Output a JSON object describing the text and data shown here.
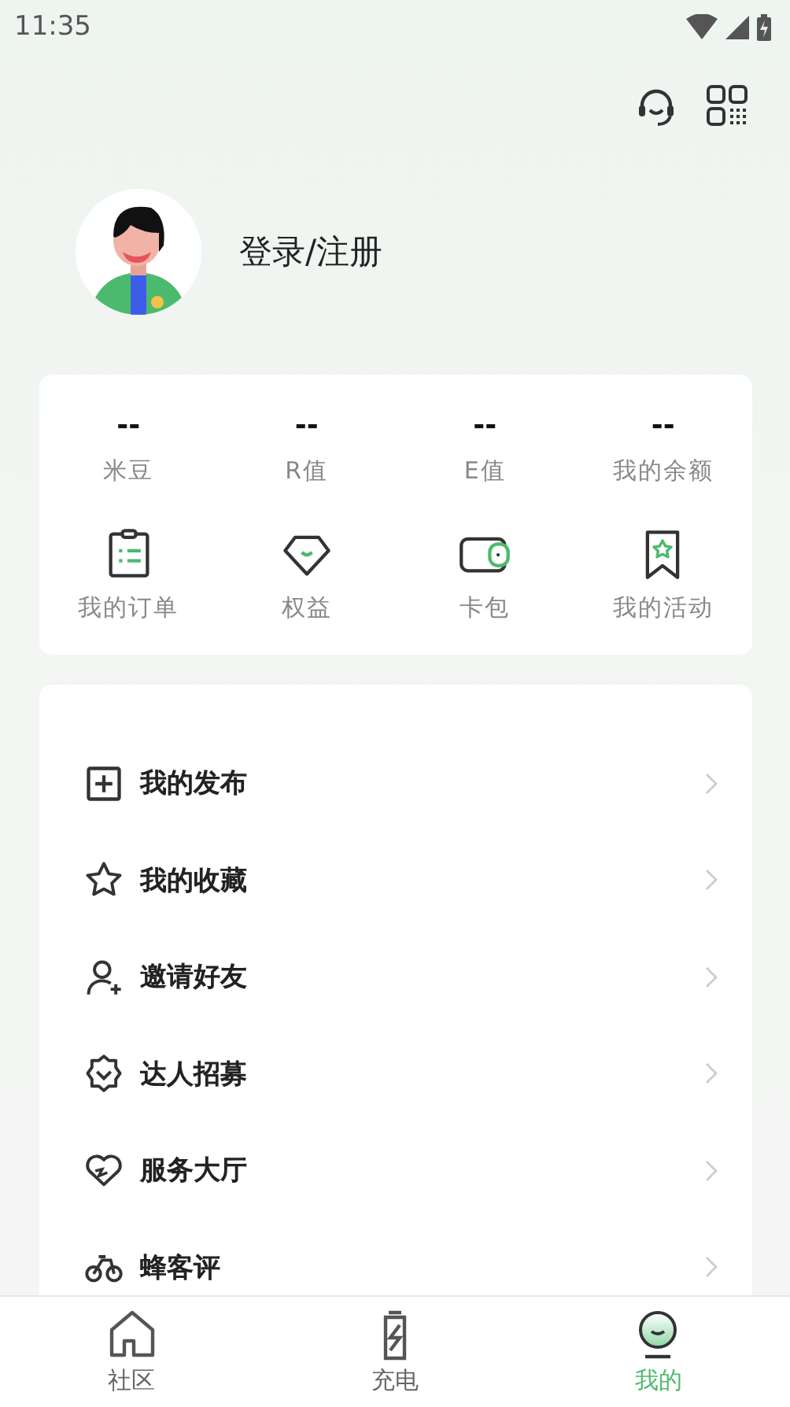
{
  "status_bar": {
    "time": "11:35"
  },
  "profile": {
    "login_label": "登录/注册"
  },
  "stats": [
    {
      "value": "--",
      "label": "米豆"
    },
    {
      "value": "--",
      "label": "R值"
    },
    {
      "value": "--",
      "label": "E值"
    },
    {
      "value": "--",
      "label": "我的余额"
    }
  ],
  "shortcuts": [
    {
      "label": "我的订单"
    },
    {
      "label": "权益"
    },
    {
      "label": "卡包"
    },
    {
      "label": "我的活动"
    }
  ],
  "menu": [
    {
      "label": "我的发布"
    },
    {
      "label": "我的收藏"
    },
    {
      "label": "邀请好友"
    },
    {
      "label": "达人招募"
    },
    {
      "label": "服务大厅"
    },
    {
      "label": "蜂客评"
    }
  ],
  "tabs": [
    {
      "label": "社区",
      "selected": false
    },
    {
      "label": "充电",
      "selected": false
    },
    {
      "label": "我的",
      "selected": true
    }
  ]
}
